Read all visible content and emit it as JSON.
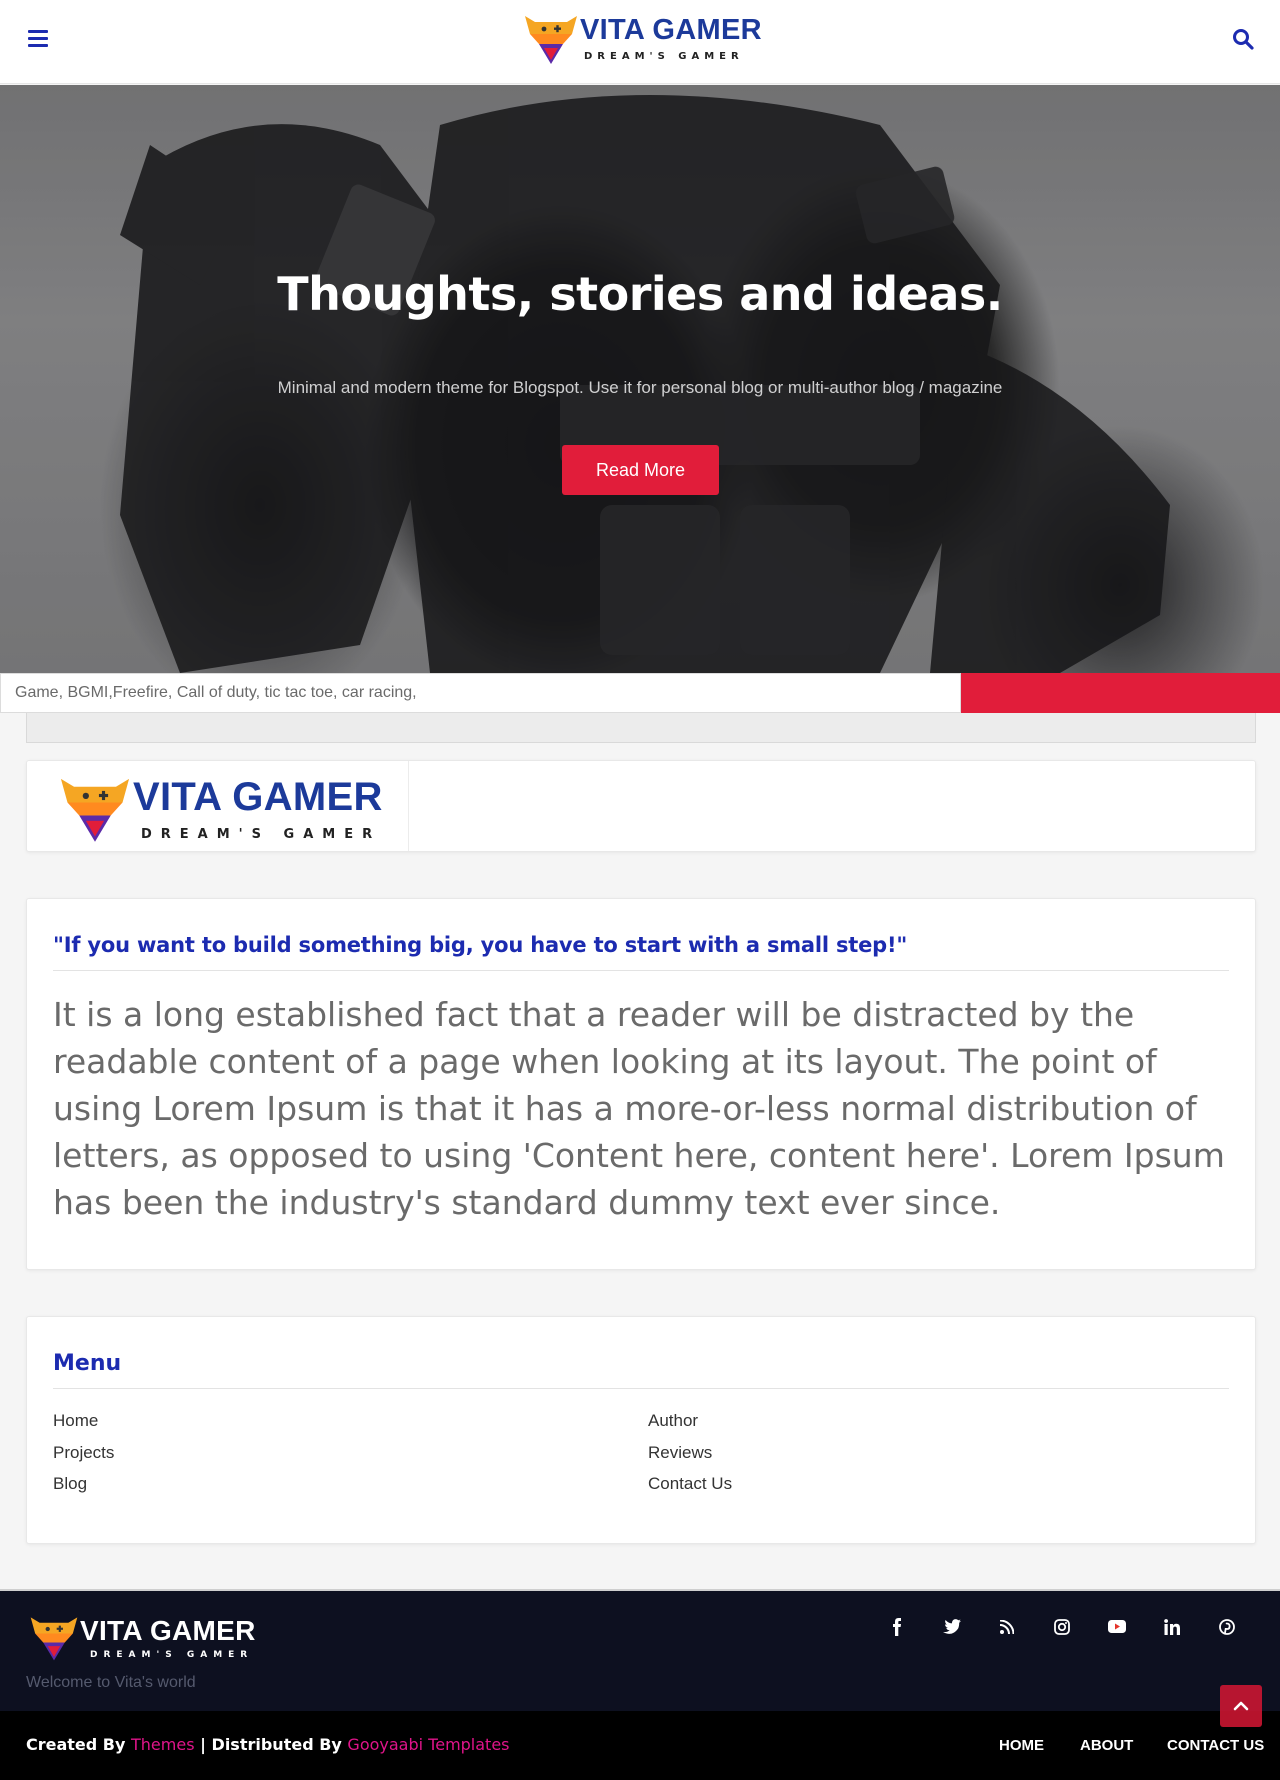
{
  "header": {
    "menu_icon": "hamburger-icon",
    "search_icon": "search-icon",
    "logo": {
      "brand": "VITA GAMER",
      "tagline": "DREAM'S GAMER"
    }
  },
  "hero": {
    "title": "Thoughts, stories and ideas.",
    "subtitle": "Minimal and modern theme for Blogspot. Use it for personal blog or multi-author blog / magazine",
    "button_label": "Read More"
  },
  "search": {
    "placeholder": "Game, BGMI,Freefire, Call of duty, tic tac toe, car racing,"
  },
  "logo_card": {
    "brand": "VITA GAMER",
    "tagline": "DREAM'S GAMER"
  },
  "quote_card": {
    "title": "\"If you want to build something big, you have to start with a small step!\"",
    "body": "It is a long established fact that a reader will be distracted by the readable content of a page when looking at its layout. The point of using Lorem Ipsum is that it has a more-or-less normal distribution of letters, as opposed to using 'Content here, content here'. Lorem Ipsum has been the industry's standard dummy text ever since."
  },
  "menu": {
    "title": "Menu",
    "col1": [
      "Home",
      "Projects",
      "Blog"
    ],
    "col2": [
      "Author",
      "Reviews",
      "Contact Us"
    ]
  },
  "footer": {
    "logo": {
      "brand": "VITA GAMER",
      "tagline": "DREAM'S GAMER"
    },
    "welcome": "Welcome to Vita's world",
    "social": [
      {
        "name": "facebook-icon",
        "glyph": "f",
        "color": "#3b5998"
      },
      {
        "name": "twitter-icon",
        "glyph": "t",
        "color": "#1da1f2"
      },
      {
        "name": "rss-icon",
        "glyph": "rss",
        "color": "#f7b500"
      },
      {
        "name": "instagram-icon",
        "glyph": "ig",
        "color": "#c13584"
      },
      {
        "name": "youtube-icon",
        "glyph": "yt",
        "color": "#e4352b"
      },
      {
        "name": "linkedin-icon",
        "glyph": "in",
        "color": "#0077b5"
      },
      {
        "name": "pinterest-icon",
        "glyph": "p",
        "color": "#d51d26"
      }
    ],
    "credits": {
      "created_by": "Created By",
      "themes": "Themes",
      "separator": "| Distributed By",
      "distributor": "Gooyaabi Templates"
    },
    "nav": [
      "HOME",
      "ABOUT",
      "CONTACT US"
    ],
    "back_to_top_icon": "chevron-up-icon"
  },
  "colors": {
    "accent": "#e11d3a",
    "heading_blue": "#1c2bb0",
    "footer_bg": "#0d1020",
    "link_pink": "#e0148a"
  }
}
